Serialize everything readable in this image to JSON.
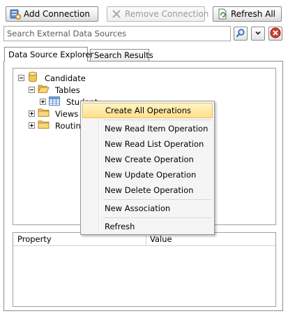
{
  "toolbar": {
    "add_connection": "Add Connection",
    "remove_connection": "Remove Connection",
    "refresh_all": "Refresh All"
  },
  "search": {
    "placeholder": "Search External Data Sources"
  },
  "tabs": [
    {
      "label": "Data Source Explorer",
      "active": true
    },
    {
      "label": "Search Results",
      "active": false
    }
  ],
  "tree": {
    "root": "Candidate",
    "tables": "Tables",
    "student": "Student",
    "views": "Views",
    "routines": "Routin"
  },
  "context_menu": {
    "items": [
      "Create All Operations",
      "New Read Item Operation",
      "New Read List Operation",
      "New Create Operation",
      "New Update Operation",
      "New Delete Operation",
      "New Association",
      "Refresh"
    ]
  },
  "property_grid": {
    "col_property": "Property",
    "col_value": "Value"
  },
  "colors": {
    "highlight": "#ffe08a",
    "remove_x": "#d43b2b",
    "folder": "#f0c65a"
  }
}
